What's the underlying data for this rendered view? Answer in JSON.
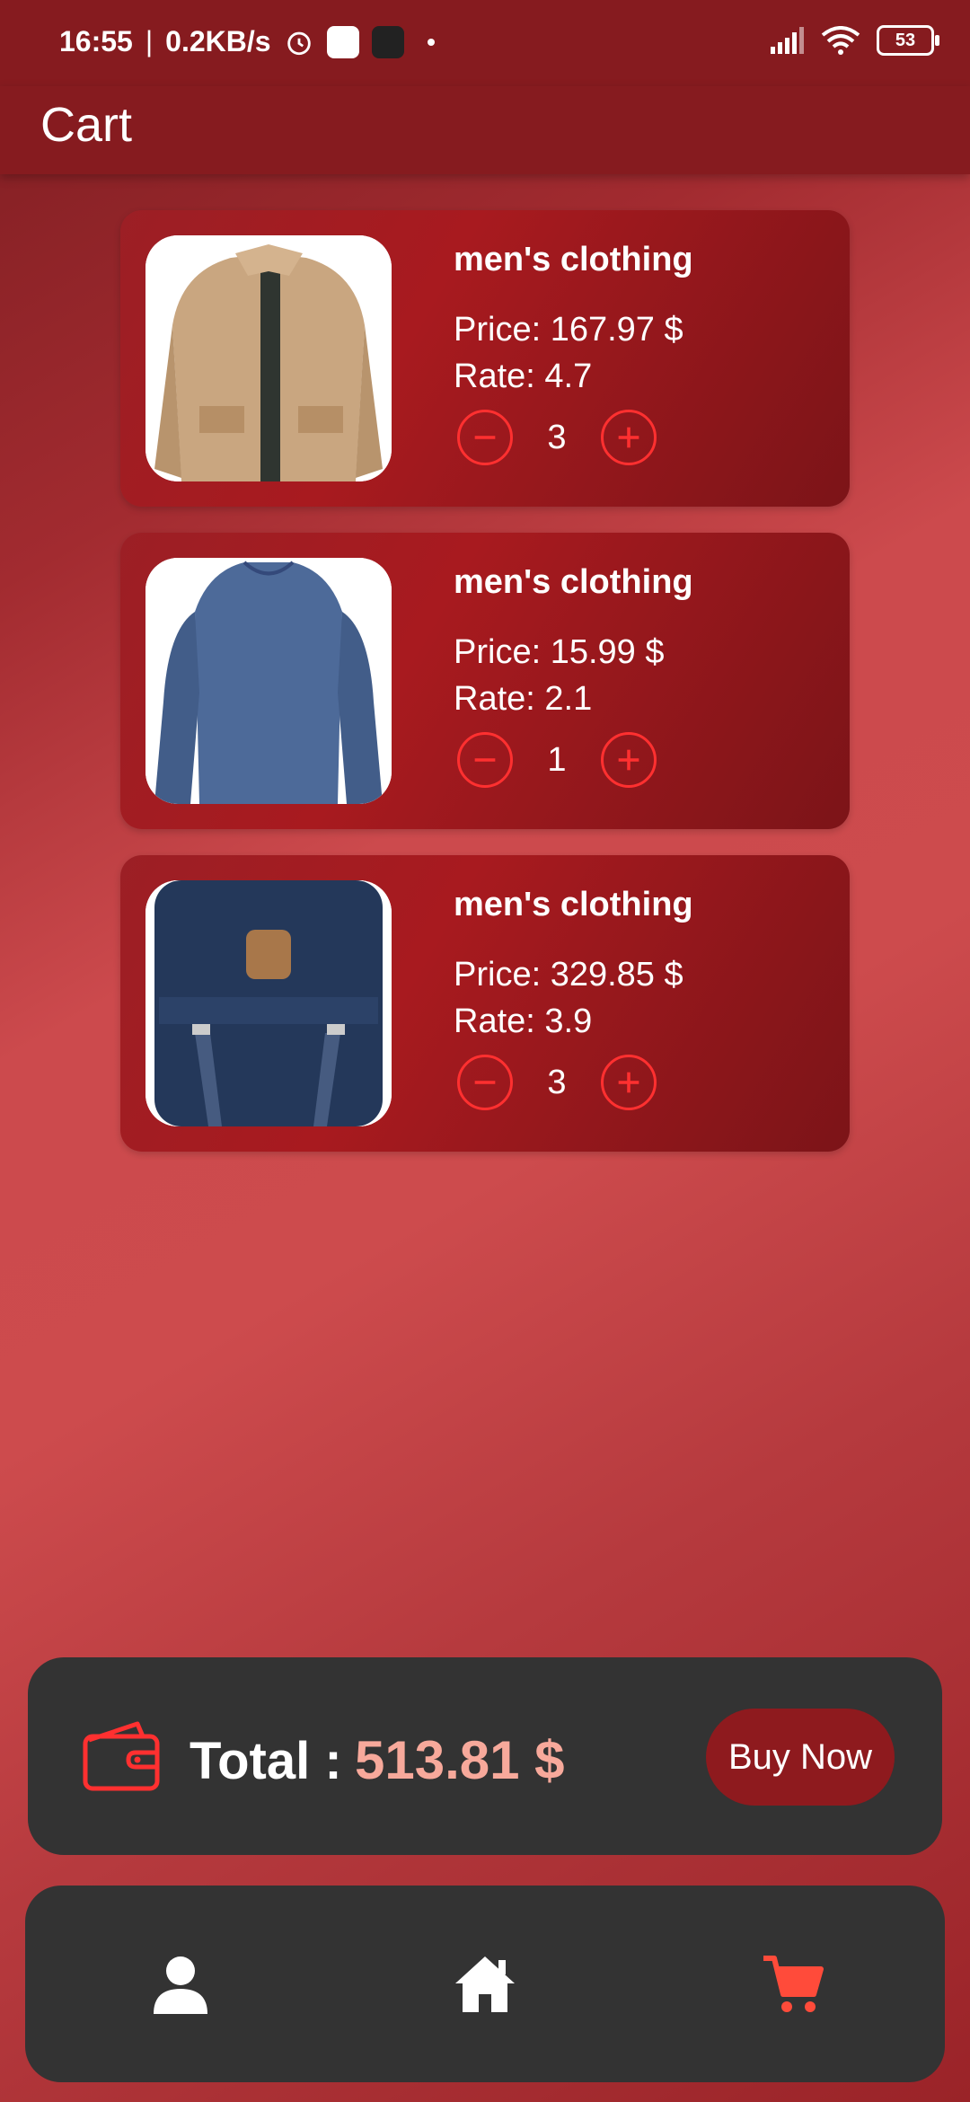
{
  "status_bar": {
    "time": "16:55",
    "separator": "|",
    "network_speed": "0.2KB/s",
    "battery_level": "53"
  },
  "app_bar": {
    "title": "Cart"
  },
  "cart_items": [
    {
      "category": "men's clothing",
      "price": "Price: 167.97 $",
      "rate": "Rate: 4.7",
      "quantity": "3",
      "image": "beige-jacket"
    },
    {
      "category": "men's clothing",
      "price": "Price: 15.99 $",
      "rate": "Rate: 2.1",
      "quantity": "1",
      "image": "blue-long-sleeve-shirt"
    },
    {
      "category": "men's clothing",
      "price": "Price: 329.85 $",
      "rate": "Rate: 3.9",
      "quantity": "3",
      "image": "navy-backpack"
    }
  ],
  "total": {
    "label": "Total :",
    "value": "513.81 $"
  },
  "buy_button": {
    "label": "Buy Now"
  },
  "bottom_nav": {
    "items": [
      {
        "icon": "person-icon",
        "active": false
      },
      {
        "icon": "home-icon",
        "active": false
      },
      {
        "icon": "cart-icon",
        "active": true
      }
    ]
  },
  "colors": {
    "accent_red": "#ff3030",
    "app_bar": "#861b1f",
    "panel_dark": "#333333",
    "total_value": "#f7a99b",
    "button": "#8e1a1e",
    "active_nav": "#ff4b3a"
  }
}
